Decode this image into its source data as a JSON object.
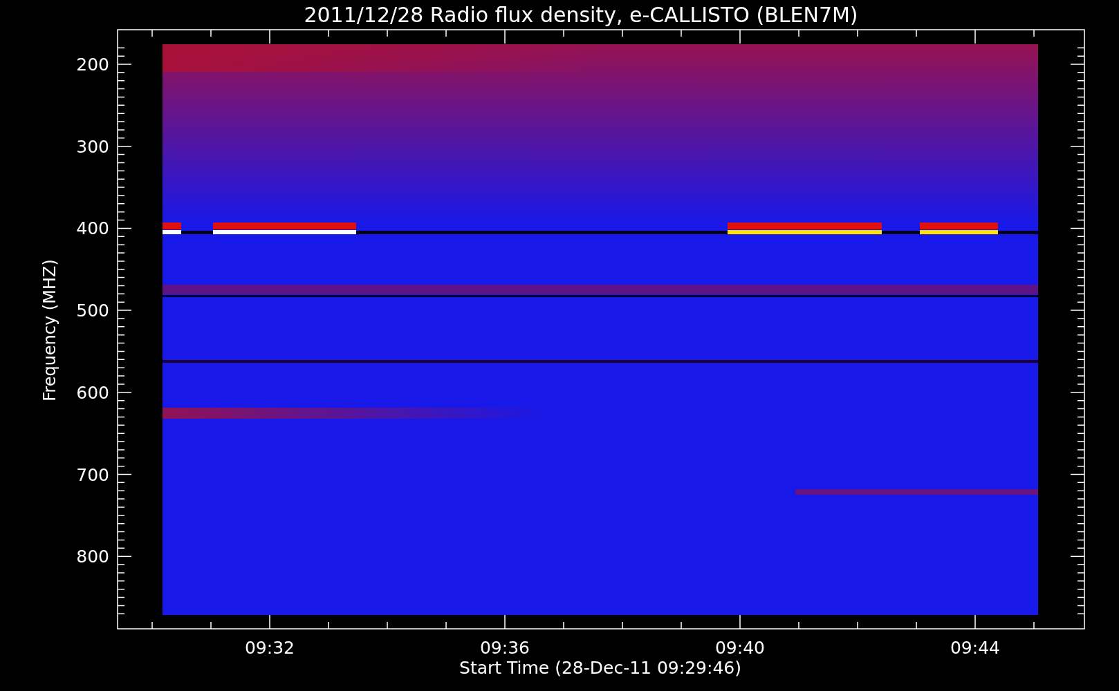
{
  "title": "2011/12/28  Radio flux density, e-CALLISTO (BLEN7M)",
  "y_axis": {
    "label": "Frequency (MHZ)",
    "tick_labels": [
      "200",
      "300",
      "400",
      "500",
      "600",
      "700",
      "800"
    ]
  },
  "x_axis": {
    "label": "Start Time (28-Dec-11 09:29:46)",
    "tick_labels": [
      "09:32",
      "09:36",
      "09:40",
      "09:44"
    ]
  }
}
